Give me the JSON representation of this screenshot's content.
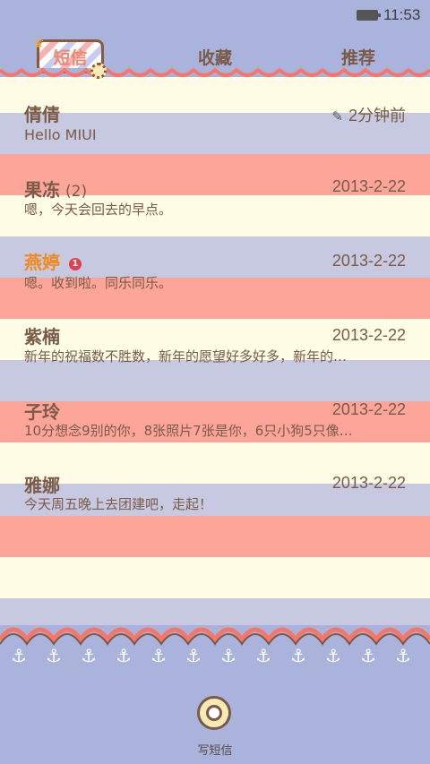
{
  "status_bar": {
    "time": "11:53"
  },
  "tabs": [
    {
      "label": "短信",
      "active": true
    },
    {
      "label": "收藏",
      "active": false
    },
    {
      "label": "推荐",
      "active": false
    }
  ],
  "conversations": [
    {
      "name": "倩倩",
      "count": "",
      "time": "2分钟前",
      "preview": "Hello MIUI",
      "unread": ""
    },
    {
      "name": "果冻",
      "count": "(2)",
      "time": "2013-2-22",
      "preview": "嗯，今天会回去的早点。",
      "unread": ""
    },
    {
      "name": "燕婷",
      "count": "",
      "time": "2013-2-22",
      "preview": "嗯。收到啦。同乐同乐。",
      "unread": "1"
    },
    {
      "name": "紫楠",
      "count": "",
      "time": "2013-2-22",
      "preview": "新年的祝福数不胜数，新年的愿望好多好多，新年的…",
      "unread": ""
    },
    {
      "name": "子玲",
      "count": "",
      "time": "2013-2-22",
      "preview": "10分想念9别的你，8张照片7张是你，6只小狗5只像…",
      "unread": ""
    },
    {
      "name": "雅娜",
      "count": "",
      "time": "2013-2-22",
      "preview": "今天周五晚上去团建吧，走起！",
      "unread": ""
    }
  ],
  "compose": {
    "label": "写短信"
  },
  "colors": {
    "background": "#a9b3dc",
    "stripe_cream": "#fffde6",
    "stripe_blue": "#c6c9e0",
    "stripe_salmon": "#fda598",
    "text_brown": "#7a5a48",
    "highlight_orange": "#f08a1c",
    "badge_red": "#e04050"
  }
}
